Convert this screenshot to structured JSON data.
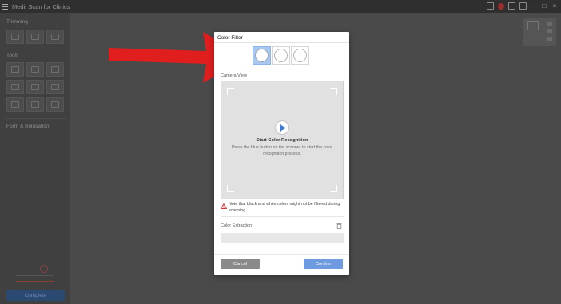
{
  "window": {
    "title": "Medit Scan for Clinics"
  },
  "left_panel": {
    "sections": [
      {
        "label": "Trimming"
      },
      {
        "label": "Tools"
      },
      {
        "label": "Form & Bolusation"
      }
    ],
    "complete_label": "Complete"
  },
  "dialog": {
    "title": "Color Filter",
    "filter_options": [
      {
        "name": "filter-1",
        "selected": true
      },
      {
        "name": "filter-2",
        "selected": false
      },
      {
        "name": "filter-3",
        "selected": false
      }
    ],
    "camera_view_label": "Camera View",
    "start_heading": "Start Color Recognition",
    "start_description": "Press the blue button on the scanner to start the color recognition process.",
    "warning_note": "Note that black and white colors might not be filtered during scanning.",
    "color_extraction_label": "Color Extraction",
    "cancel_label": "Cancel",
    "confirm_label": "Confirm"
  },
  "colors": {
    "arrow": "#e01e1e",
    "selected_filter": "#a9c8f0",
    "confirm_button": "#6e9ae0",
    "cancel_button": "#8a8a8a",
    "complete_button": "#2b4a72"
  },
  "icons": [
    "menu-icon",
    "play-icon",
    "warning-icon",
    "trash-icon",
    "red-arrow-annotation"
  ]
}
